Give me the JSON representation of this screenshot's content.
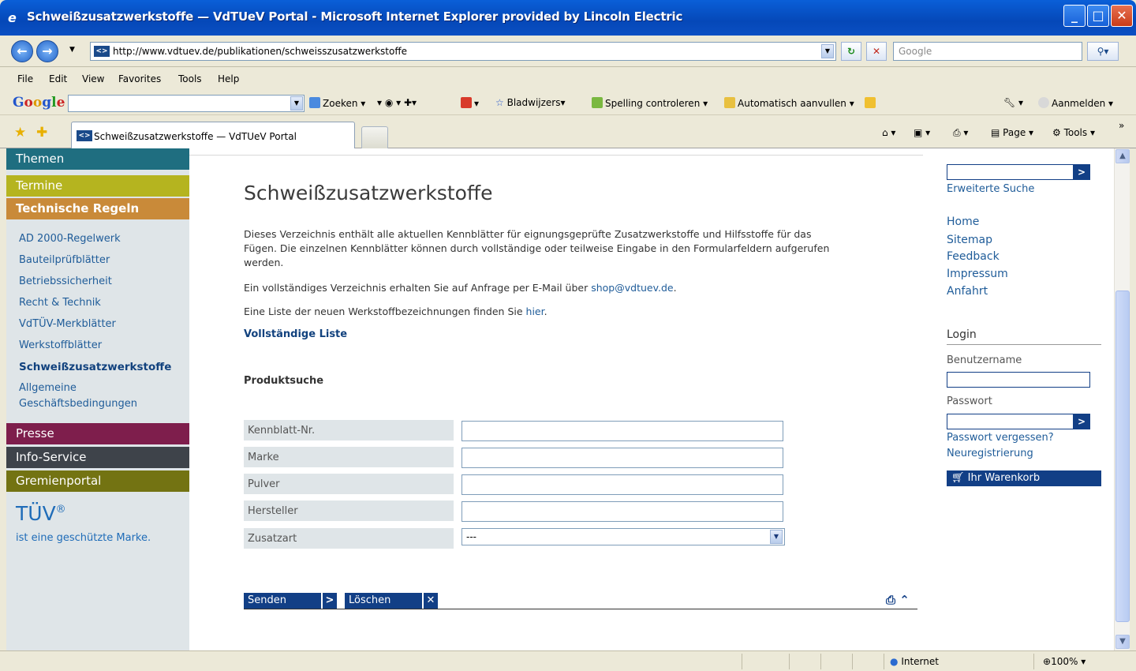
{
  "window": {
    "title": "Schweißzusatzwerkstoffe — VdTUeV Portal - Microsoft Internet Explorer provided by Lincoln Electric"
  },
  "addressbar": {
    "url": "http://www.vdtuev.de/publikationen/schweisszusatzwerkstoffe",
    "search_placeholder": "Google"
  },
  "menu": [
    "File",
    "Edit",
    "View",
    "Favorites",
    "Tools",
    "Help"
  ],
  "google_toolbar": {
    "search_label": "Zoeken",
    "bookmarks": "Bladwijzers",
    "spellcheck": "Spelling controleren",
    "autofill": "Automatisch aanvullen",
    "signin": "Aanmelden"
  },
  "tabs": [
    {
      "label": "Schweißzusatzwerkstoffe — VdTUeV Portal"
    }
  ],
  "commandbar": {
    "page": "Page",
    "tools": "Tools"
  },
  "sidebar": {
    "headers_top": [
      {
        "label": "Themen",
        "color": "#1f6e80"
      },
      {
        "label": "Termine",
        "color": "#b5b41f"
      },
      {
        "label": "Technische Regeln",
        "color": "#c98a39"
      }
    ],
    "items": [
      {
        "label": "AD 2000-Regelwerk"
      },
      {
        "label": "Bauteilprüfblätter"
      },
      {
        "label": "Betriebssicherheit"
      },
      {
        "label": "Recht & Technik"
      },
      {
        "label": "VdTÜV-Merkblätter"
      },
      {
        "label": "Werkstoffblätter"
      },
      {
        "label": "Schweißzusatzwerkstoffe",
        "active": true
      },
      {
        "label": "Allgemeine"
      },
      {
        "label": "Geschäftsbedingungen"
      }
    ],
    "headers_bottom": [
      {
        "label": "Presse",
        "color": "#7e1e4c"
      },
      {
        "label": "Info-Service",
        "color": "#3e434a"
      },
      {
        "label": "Gremienportal",
        "color": "#737312"
      }
    ],
    "brand": "TÜV",
    "brand_mark": "®",
    "brand_subtitle": "ist eine geschützte Marke."
  },
  "main": {
    "title": "Schweißzusatzwerkstoffe",
    "intro_line1": "Dieses Verzeichnis enthält alle aktuellen Kennblätter für eignungsgeprüfte Zusatzwerkstoffe und Hilfsstoffe für das",
    "intro_line2": "Fügen. Die einzelnen Kennblätter können durch vollständige oder teilweise Eingabe in den Formularfeldern aufgerufen",
    "intro_line3": "werden.",
    "request_text": "Ein vollständiges Verzeichnis erhalten Sie auf Anfrage per E-Mail über ",
    "request_email": "shop@vdtuev.de",
    "request_end": ".",
    "newlist_text": "Eine Liste der neuen Werkstoffbezeichnungen finden Sie ",
    "newlist_link": "hier",
    "newlist_end": ".",
    "full_list": "Vollständige Liste",
    "search_heading": "Produktsuche",
    "fields": [
      {
        "label": "Kennblatt-Nr.",
        "value": ""
      },
      {
        "label": "Marke",
        "value": ""
      },
      {
        "label": "Pulver",
        "value": ""
      },
      {
        "label": "Hersteller",
        "value": ""
      }
    ],
    "select_label": "Zusatzart",
    "select_value": "---",
    "submit": "Senden",
    "reset": "Löschen"
  },
  "rightcol": {
    "advanced_search": "Erweiterte Suche",
    "links": [
      "Home",
      "Sitemap",
      "Feedback",
      "Impressum",
      "Anfahrt"
    ],
    "login_heading": "Login",
    "username_label": "Benutzername",
    "password_label": "Passwort",
    "forgot": "Passwort vergessen?",
    "register": "Neuregistrierung",
    "cart": "Ihr Warenkorb"
  },
  "statusbar": {
    "zone": "Internet",
    "zoom": "100%"
  }
}
